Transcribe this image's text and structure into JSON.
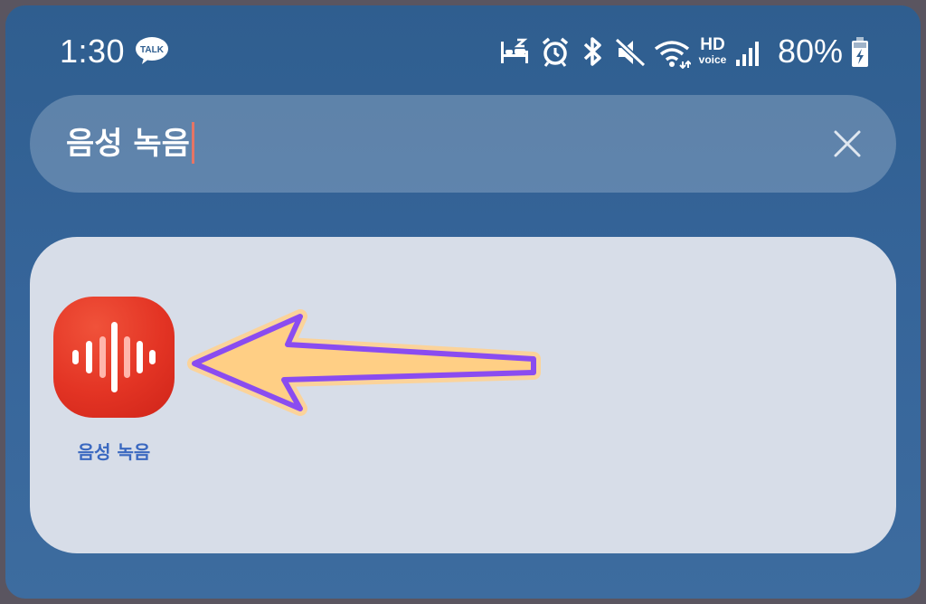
{
  "status_bar": {
    "time": "1:30",
    "talk_badge": "TALK",
    "hd_label": "HD",
    "voice_label": "voice",
    "battery": "80%",
    "icons": [
      "kakaotalk-icon",
      "sleep-mode-icon",
      "alarm-icon",
      "bluetooth-icon",
      "mute-icon",
      "wifi-icon",
      "hd-voice-icon",
      "signal-icon",
      "battery-charging-icon"
    ]
  },
  "search": {
    "query": "음성 녹음",
    "clear_icon": "close-icon"
  },
  "results": {
    "apps": [
      {
        "label": "음성 녹음",
        "icon": "voice-recorder-app-icon",
        "icon_color": "#e33424"
      }
    ]
  },
  "annotation": {
    "arrow_fill": "#ffcf85",
    "arrow_stroke": "#8a4cf0"
  }
}
